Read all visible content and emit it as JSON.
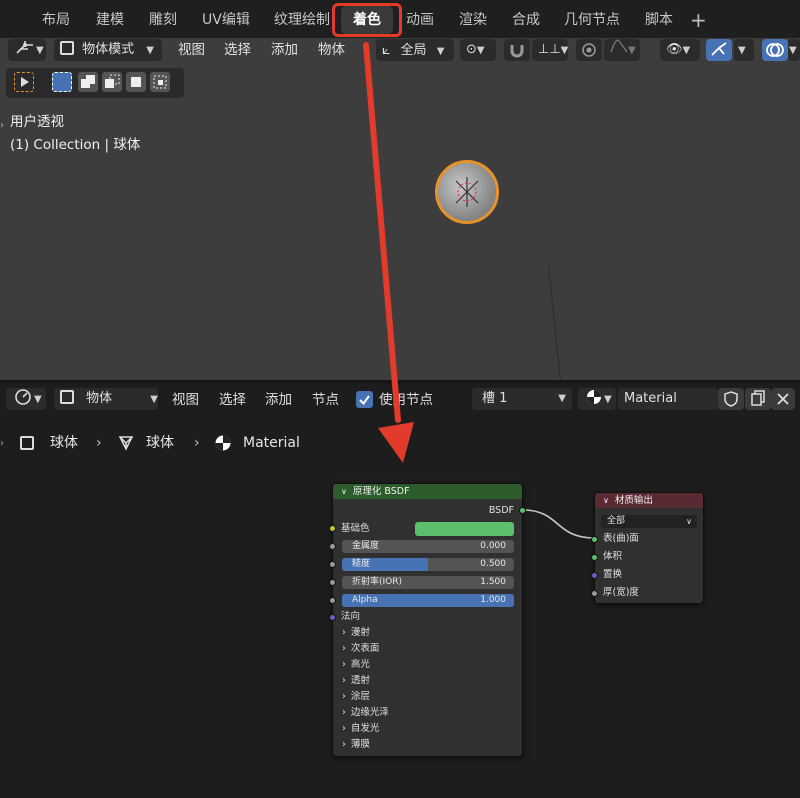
{
  "workspace_tabs": [
    "布局",
    "建模",
    "雕刻",
    "UV编辑",
    "纹理绘制",
    "着色",
    "动画",
    "渲染",
    "合成",
    "几何节点",
    "脚本"
  ],
  "active_tab": "着色",
  "viewport": {
    "mode": "物体模式",
    "menus": [
      "视图",
      "选择",
      "添加",
      "物体"
    ],
    "transform_orientation": "全局",
    "overlay_title": "用户透视",
    "overlay_subtitle": "(1) Collection | 球体"
  },
  "node_editor": {
    "editor_type_label": "物体",
    "menus": [
      "视图",
      "选择",
      "添加",
      "节点"
    ],
    "use_nodes_label": "使用节点",
    "use_nodes_checked": true,
    "slot": "槽 1",
    "material_name": "Material",
    "breadcrumb": [
      "球体",
      "球体",
      "Material"
    ]
  },
  "bsdf_node": {
    "title": "原理化 BSDF",
    "output": "BSDF",
    "base_color_label": "基础色",
    "base_color": "#5bbf6c",
    "fields": [
      {
        "label": "金属度",
        "value": "0.000",
        "fill": 0.0
      },
      {
        "label": "糙度",
        "value": "0.500",
        "fill": 0.5
      },
      {
        "label": "折射率(IOR)",
        "value": "1.500",
        "fill": 0.0
      },
      {
        "label": "Alpha",
        "value": "1.000",
        "fill": 1.0
      }
    ],
    "normal_label": "法向",
    "panels": [
      "漫射",
      "次表面",
      "高光",
      "透射",
      "涂层",
      "边缘光泽",
      "自发光",
      "薄膜"
    ]
  },
  "output_node": {
    "title": "材质输出",
    "target": "全部",
    "inputs": [
      "表(曲)面",
      "体积",
      "置换",
      "厚(宽)度"
    ]
  },
  "colors": {
    "highlight": "#e23a2b",
    "accent_blue": "#4772b3",
    "bsdf_header": "#2c5c2b",
    "output_header": "#5a2a33",
    "selection_orange": "#e8922e"
  }
}
